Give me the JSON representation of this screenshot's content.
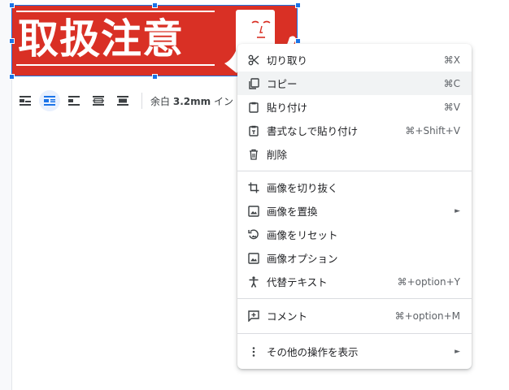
{
  "image": {
    "text": "取扱注意",
    "background_color": "#d93025"
  },
  "toolbar": {
    "icons": [
      "wrap-inline-icon",
      "wrap-text-icon",
      "break-text-icon",
      "behind-text-icon",
      "in-front-text-icon"
    ],
    "margin_label": "余白",
    "margin_value": "3.2mm",
    "margin_suffix": "イン"
  },
  "menu": {
    "items": [
      {
        "label": "切り取り",
        "shortcut": "⌘X",
        "icon": "scissors-icon"
      },
      {
        "label": "コピー",
        "shortcut": "⌘C",
        "icon": "copy-icon"
      },
      {
        "label": "貼り付け",
        "shortcut": "⌘V",
        "icon": "paste-icon"
      },
      {
        "label": "書式なしで貼り付け",
        "shortcut": "⌘+Shift+V",
        "icon": "paste-plain-icon"
      },
      {
        "label": "削除",
        "shortcut": "",
        "icon": "trash-icon"
      },
      {
        "label": "画像を切り抜く",
        "shortcut": "",
        "icon": "crop-icon"
      },
      {
        "label": "画像を置換",
        "shortcut": "",
        "icon": "image-icon",
        "submenu": "►"
      },
      {
        "label": "画像をリセット",
        "shortcut": "",
        "icon": "reset-image-icon"
      },
      {
        "label": "画像オプション",
        "shortcut": "",
        "icon": "image-options-icon"
      },
      {
        "label": "代替テキスト",
        "shortcut": "⌘+option+Y",
        "icon": "accessibility-icon"
      },
      {
        "label": "コメント",
        "shortcut": "⌘+option+M",
        "icon": "add-comment-icon"
      },
      {
        "label": "その他の操作を表示",
        "shortcut": "",
        "icon": "more-vert-icon",
        "submenu": "►"
      }
    ]
  },
  "colors": {
    "accent": "#1a73e8",
    "hover": "#f1f3f4"
  }
}
